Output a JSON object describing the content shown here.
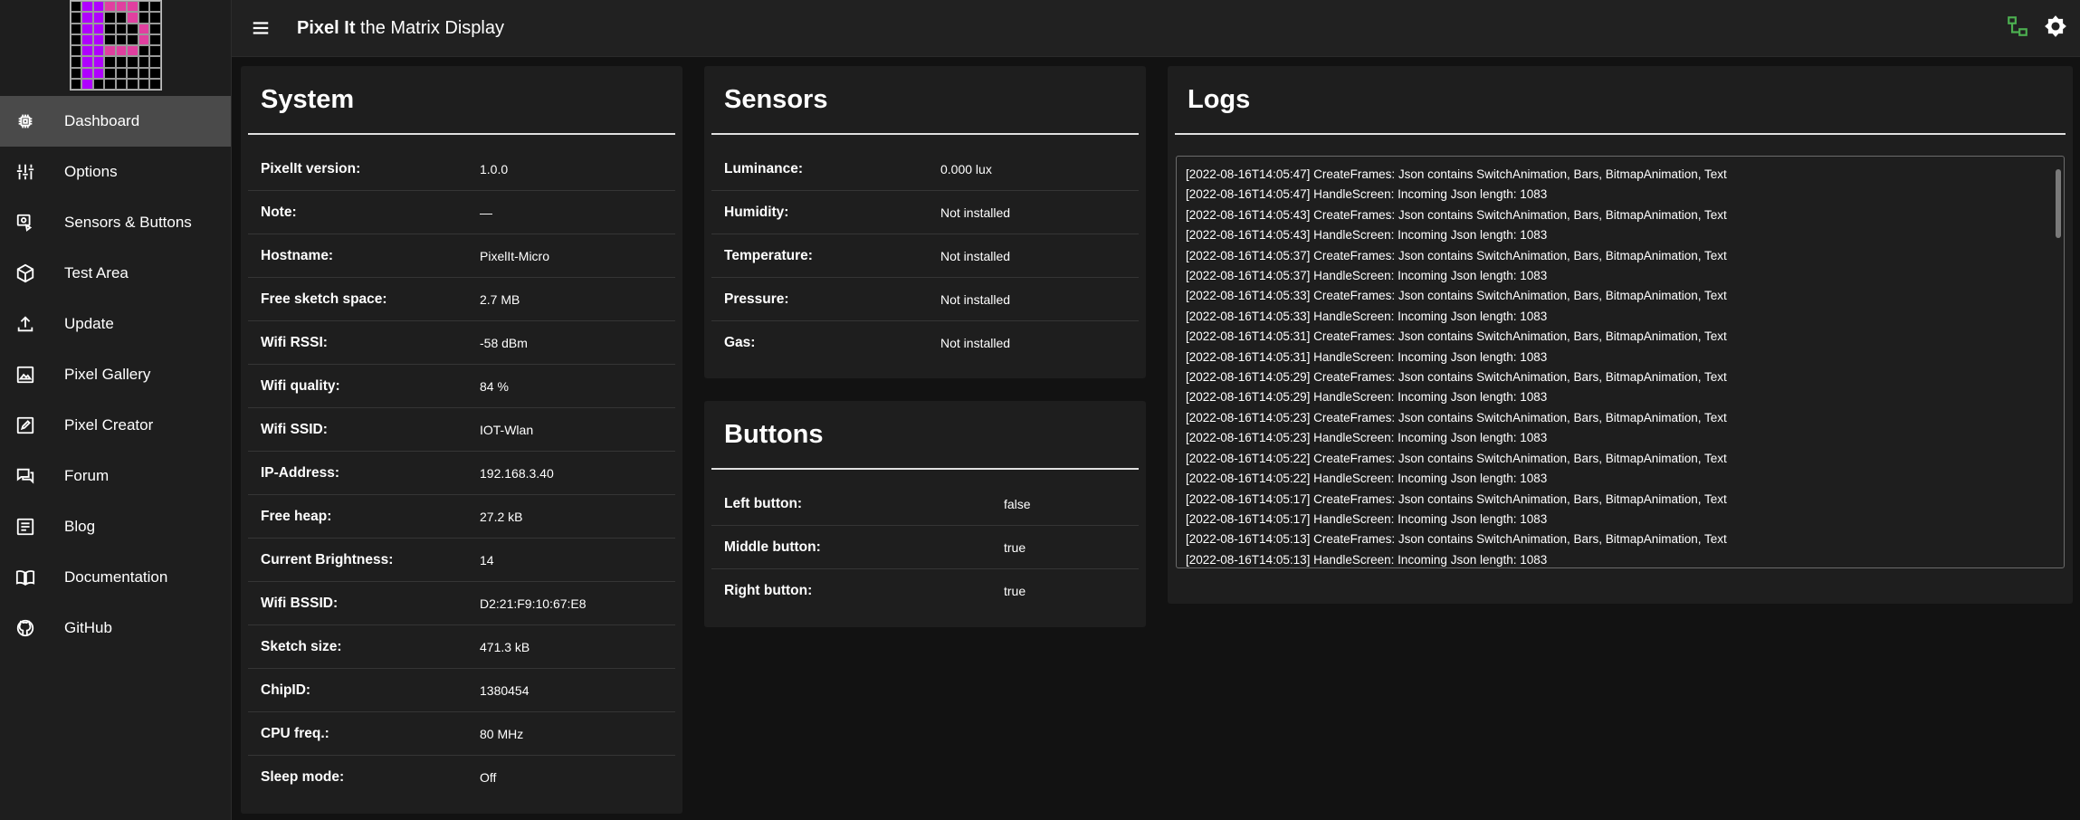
{
  "app": {
    "title_bold": "Pixel It",
    "title_rest": " the Matrix Display"
  },
  "colors": {
    "accent_magenta": "#b000ff",
    "accent_pink": "#e040a0",
    "status_green": "#4caf50"
  },
  "sidebar": {
    "items": [
      {
        "label": "Dashboard",
        "icon": "chip-icon",
        "active": true
      },
      {
        "label": "Options",
        "icon": "tune-icon"
      },
      {
        "label": "Sensors & Buttons",
        "icon": "sensor-touch-icon"
      },
      {
        "label": "Test Area",
        "icon": "cube-icon"
      },
      {
        "label": "Update",
        "icon": "upload-icon"
      },
      {
        "label": "Pixel Gallery",
        "icon": "image-icon"
      },
      {
        "label": "Pixel Creator",
        "icon": "edit-box-icon"
      },
      {
        "label": "Forum",
        "icon": "forum-icon"
      },
      {
        "label": "Blog",
        "icon": "newspaper-icon"
      },
      {
        "label": "Documentation",
        "icon": "book-icon"
      },
      {
        "label": "GitHub",
        "icon": "github-icon"
      }
    ]
  },
  "system": {
    "title": "System",
    "rows": [
      {
        "key": "PixelIt version:",
        "value": "1.0.0"
      },
      {
        "key": "Note:",
        "value": "—"
      },
      {
        "key": "Hostname:",
        "value": "PixelIt-Micro"
      },
      {
        "key": "Free sketch space:",
        "value": "2.7 MB"
      },
      {
        "key": "Wifi RSSI:",
        "value": "-58 dBm"
      },
      {
        "key": "Wifi quality:",
        "value": "84 %"
      },
      {
        "key": "Wifi SSID:",
        "value": "IOT-Wlan"
      },
      {
        "key": "IP-Address:",
        "value": "192.168.3.40"
      },
      {
        "key": "Free heap:",
        "value": "27.2 kB"
      },
      {
        "key": "Current Brightness:",
        "value": "14"
      },
      {
        "key": "Wifi BSSID:",
        "value": "D2:21:F9:10:67:E8"
      },
      {
        "key": "Sketch size:",
        "value": "471.3 kB"
      },
      {
        "key": "ChipID:",
        "value": "1380454"
      },
      {
        "key": "CPU freq.:",
        "value": "80 MHz"
      },
      {
        "key": "Sleep mode:",
        "value": "Off"
      }
    ]
  },
  "sensors": {
    "title": "Sensors",
    "rows": [
      {
        "key": "Luminance:",
        "value": "0.000 lux"
      },
      {
        "key": "Humidity:",
        "value": "Not installed"
      },
      {
        "key": "Temperature:",
        "value": "Not installed"
      },
      {
        "key": "Pressure:",
        "value": "Not installed"
      },
      {
        "key": "Gas:",
        "value": "Not installed"
      }
    ]
  },
  "buttons": {
    "title": "Buttons",
    "rows": [
      {
        "key": "Left button:",
        "value": "false"
      },
      {
        "key": "Middle button:",
        "value": "true"
      },
      {
        "key": "Right button:",
        "value": "true"
      }
    ]
  },
  "logs": {
    "title": "Logs",
    "lines": [
      "[2022-08-16T14:05:47] CreateFrames: Json contains SwitchAnimation, Bars, BitmapAnimation, Text",
      "[2022-08-16T14:05:47] HandleScreen: Incoming Json length: 1083",
      "[2022-08-16T14:05:43] CreateFrames: Json contains SwitchAnimation, Bars, BitmapAnimation, Text",
      "[2022-08-16T14:05:43] HandleScreen: Incoming Json length: 1083",
      "[2022-08-16T14:05:37] CreateFrames: Json contains SwitchAnimation, Bars, BitmapAnimation, Text",
      "[2022-08-16T14:05:37] HandleScreen: Incoming Json length: 1083",
      "[2022-08-16T14:05:33] CreateFrames: Json contains SwitchAnimation, Bars, BitmapAnimation, Text",
      "[2022-08-16T14:05:33] HandleScreen: Incoming Json length: 1083",
      "[2022-08-16T14:05:31] CreateFrames: Json contains SwitchAnimation, Bars, BitmapAnimation, Text",
      "[2022-08-16T14:05:31] HandleScreen: Incoming Json length: 1083",
      "[2022-08-16T14:05:29] CreateFrames: Json contains SwitchAnimation, Bars, BitmapAnimation, Text",
      "[2022-08-16T14:05:29] HandleScreen: Incoming Json length: 1083",
      "[2022-08-16T14:05:23] CreateFrames: Json contains SwitchAnimation, Bars, BitmapAnimation, Text",
      "[2022-08-16T14:05:23] HandleScreen: Incoming Json length: 1083",
      "[2022-08-16T14:05:22] CreateFrames: Json contains SwitchAnimation, Bars, BitmapAnimation, Text",
      "[2022-08-16T14:05:22] HandleScreen: Incoming Json length: 1083",
      "[2022-08-16T14:05:17] CreateFrames: Json contains SwitchAnimation, Bars, BitmapAnimation, Text",
      "[2022-08-16T14:05:17] HandleScreen: Incoming Json length: 1083",
      "[2022-08-16T14:05:13] CreateFrames: Json contains SwitchAnimation, Bars, BitmapAnimation, Text",
      "[2022-08-16T14:05:13] HandleScreen: Incoming Json length: 1083"
    ]
  }
}
